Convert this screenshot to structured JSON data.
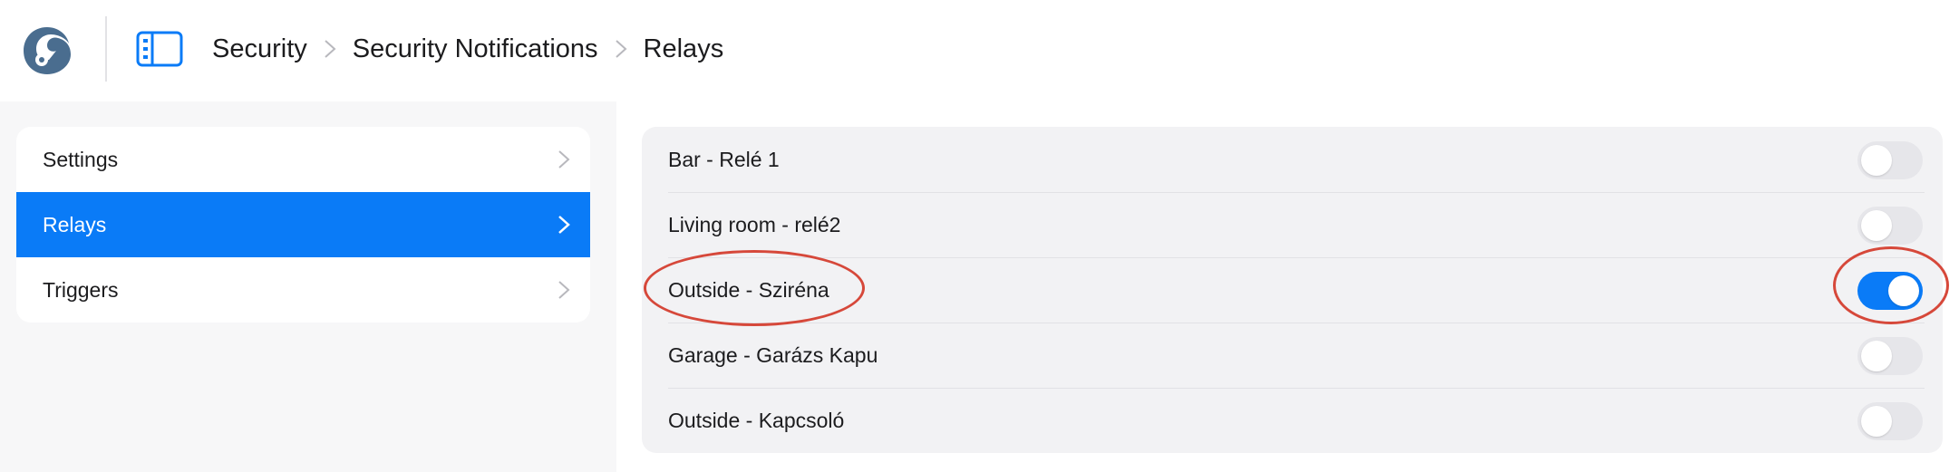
{
  "header": {
    "logo_icon": "chameleon-logo-icon",
    "sidebar_toggle_icon": "sidebar-toggle-icon",
    "breadcrumb": [
      "Security",
      "Security Notifications",
      "Relays"
    ]
  },
  "sidebar": {
    "items": [
      {
        "label": "Settings",
        "active": false
      },
      {
        "label": "Relays",
        "active": true
      },
      {
        "label": "Triggers",
        "active": false
      }
    ]
  },
  "relays": [
    {
      "label": "Bar - Relé 1",
      "enabled": false
    },
    {
      "label": "Living room - relé2",
      "enabled": false
    },
    {
      "label": "Outside - Sziréna",
      "enabled": true
    },
    {
      "label": "Garage - Garázs Kapu",
      "enabled": false
    },
    {
      "label": "Outside - Kapcsoló",
      "enabled": false
    }
  ],
  "colors": {
    "accent": "#0a7bf7",
    "annotation": "#d6483a",
    "toggle_off": "#e6e6ea",
    "logo": "#4a6d8f"
  }
}
